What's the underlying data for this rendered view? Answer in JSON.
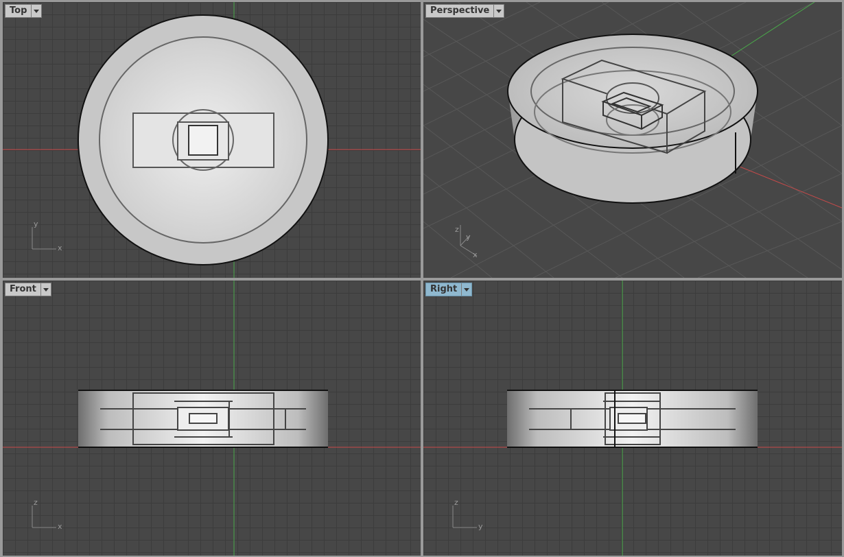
{
  "viewports": [
    {
      "id": "top",
      "label": "Top",
      "active": false,
      "axes": [
        "y",
        "x"
      ]
    },
    {
      "id": "perspective",
      "label": "Perspective",
      "active": false,
      "axes": [
        "z",
        "y",
        "x"
      ]
    },
    {
      "id": "front",
      "label": "Front",
      "active": false,
      "axes": [
        "z",
        "x"
      ]
    },
    {
      "id": "right",
      "label": "Right",
      "active": true,
      "axes": [
        "z",
        "y"
      ]
    }
  ],
  "icons": {
    "viewport_menu": "dropdown-arrow-icon"
  },
  "colors": {
    "x_axis": "#c84a4a",
    "y_axis": "#4aa84a",
    "grid": "#3c3c3c",
    "background": "#474747",
    "active_tab": "#8fb8cf"
  }
}
